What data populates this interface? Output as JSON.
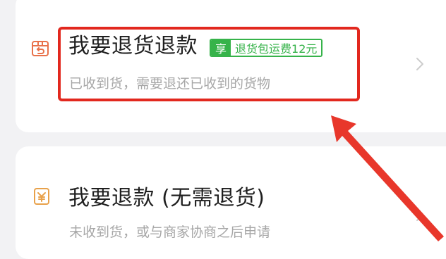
{
  "options": [
    {
      "title": "我要退货退款",
      "badge_tag": "享",
      "badge_text": "退货包运费12元",
      "description": "已收到货，需要退还已收到的货物",
      "icon": "return-box-icon"
    },
    {
      "title": "我要退款 (无需退货)",
      "description": "未收到货，或与商家协商之后申请",
      "icon": "refund-yen-icon"
    }
  ],
  "colors": {
    "accent_orange": "#e8714a",
    "badge_green": "#36b34a",
    "highlight_red": "#e2281e"
  }
}
